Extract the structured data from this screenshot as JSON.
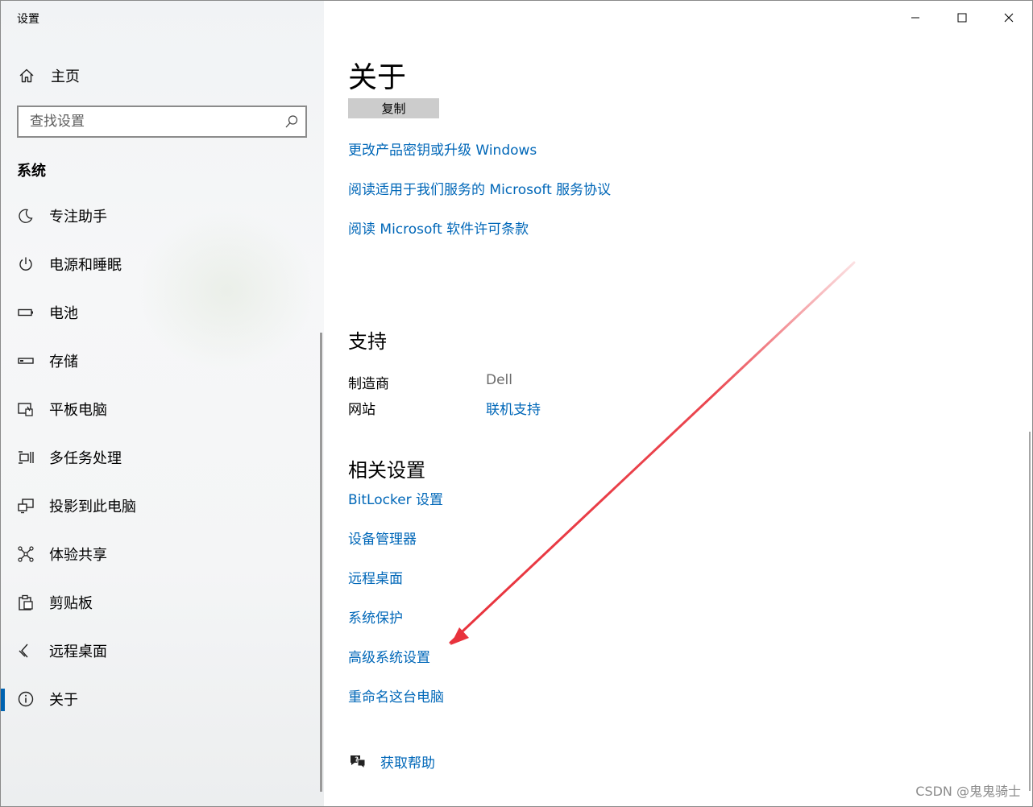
{
  "window": {
    "title": "设置"
  },
  "sidebar": {
    "home_label": "主页",
    "search_placeholder": "查找设置",
    "section_label": "系统",
    "items": [
      {
        "label": "专注助手",
        "icon": "moon-icon"
      },
      {
        "label": "电源和睡眠",
        "icon": "power-icon"
      },
      {
        "label": "电池",
        "icon": "battery-icon"
      },
      {
        "label": "存储",
        "icon": "storage-icon"
      },
      {
        "label": "平板电脑",
        "icon": "tablet-icon"
      },
      {
        "label": "多任务处理",
        "icon": "multitasking-icon"
      },
      {
        "label": "投影到此电脑",
        "icon": "project-icon"
      },
      {
        "label": "体验共享",
        "icon": "share-icon"
      },
      {
        "label": "剪贴板",
        "icon": "clipboard-icon"
      },
      {
        "label": "远程桌面",
        "icon": "remote-desktop-icon"
      },
      {
        "label": "关于",
        "icon": "info-icon",
        "selected": true
      }
    ]
  },
  "main": {
    "title": "关于",
    "copy_button": "复制",
    "links": [
      "更改产品密钥或升级 Windows",
      "阅读适用于我们服务的 Microsoft 服务协议",
      "阅读 Microsoft 软件许可条款"
    ],
    "support": {
      "heading": "支持",
      "manufacturer_label": "制造商",
      "manufacturer_value": "Dell",
      "website_label": "网站",
      "website_value": "联机支持"
    },
    "related": {
      "heading": "相关设置",
      "links": [
        "BitLocker 设置",
        "设备管理器",
        "远程桌面",
        "系统保护",
        "高级系统设置",
        "重命名这台电脑"
      ]
    },
    "help_label": "获取帮助"
  },
  "watermark": "CSDN @鬼鬼骑士",
  "colors": {
    "accent": "#0063b1",
    "link": "#0067b8",
    "annotation_arrow": "#e8323c"
  }
}
